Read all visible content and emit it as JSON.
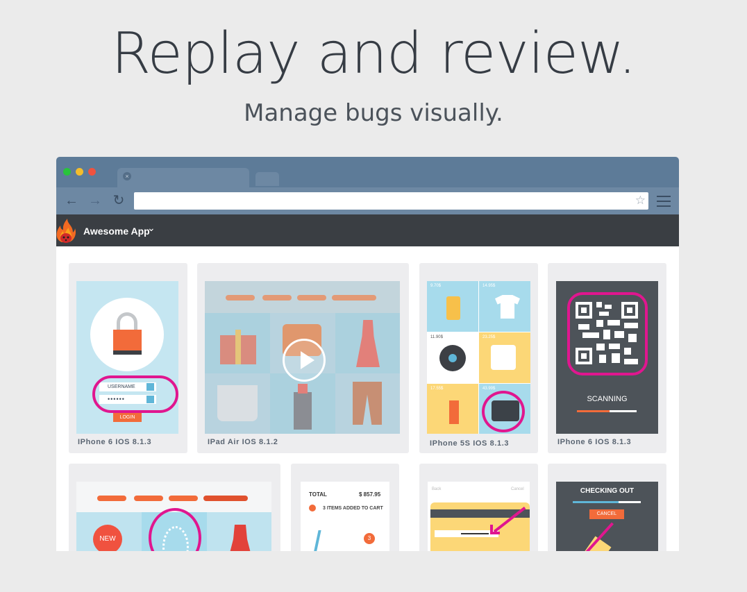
{
  "hero": {
    "title": "Replay and review.",
    "subtitle": "Manage bugs visually."
  },
  "browser": {
    "traffic_colors": {
      "close": "#28c43b",
      "minimize": "#f3bd2c",
      "zoom": "#f0523f"
    },
    "icons": [
      "back-arrow-icon",
      "forward-arrow-icon",
      "reload-icon",
      "star-icon",
      "hamburger-menu-icon"
    ],
    "url": ""
  },
  "app": {
    "name": "Awesome App",
    "accent": "#e0168f"
  },
  "cards": [
    {
      "caption": "IPhone 6  IOS 8.1.3",
      "fields": {
        "username": "USERNAME",
        "password": "••••••",
        "login": "LOGIN"
      }
    },
    {
      "caption": "IPad Air  IOS 8.1.2"
    },
    {
      "caption": "IPhone 5S  IOS 8.1.3",
      "prices": [
        "9.70$",
        "14.95$",
        "11.90$",
        "23.25$",
        "17.55$",
        "43.99$"
      ]
    },
    {
      "caption": "IPhone 6  IOS 8.1.3",
      "status": "SCANNING",
      "progress": 0.55
    },
    {
      "badge": "NEW"
    },
    {
      "total_label": "TOTAL",
      "total_value": "$ 857.95",
      "added": "3 ITEMS ADDED TO CART",
      "cart_count": "3"
    },
    {
      "back": "Back",
      "cancel_link": "Cancel"
    },
    {
      "status": "CHECKING OUT",
      "cancel": "CANCEL"
    }
  ]
}
